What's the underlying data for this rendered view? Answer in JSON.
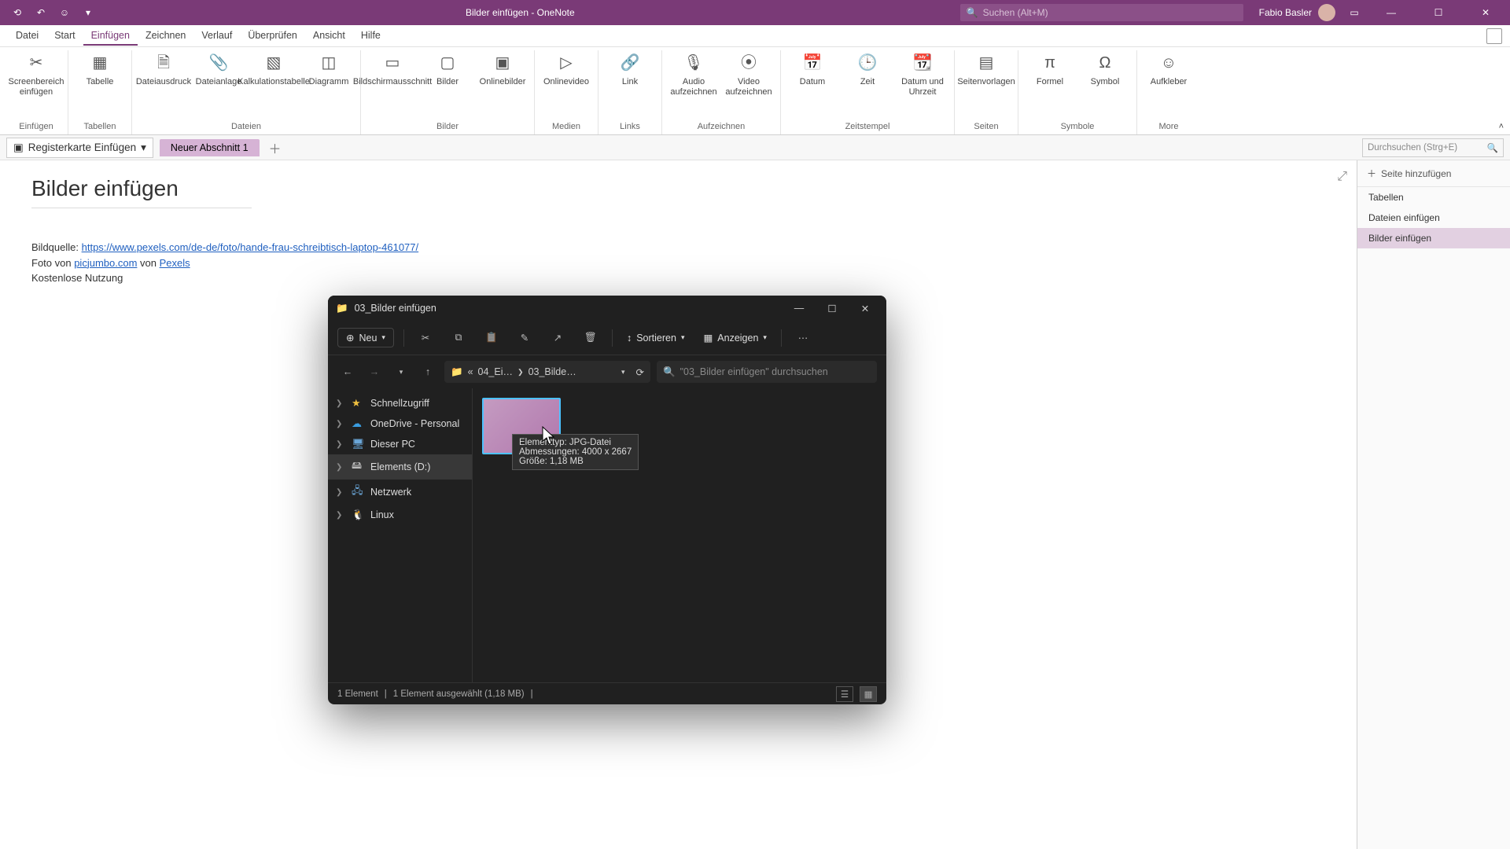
{
  "titlebar": {
    "doc_title": "Bilder einfügen  -  OneNote",
    "search_placeholder": "Suchen (Alt+M)",
    "user_name": "Fabio Basler"
  },
  "menu": {
    "tabs": [
      "Datei",
      "Start",
      "Einfügen",
      "Zeichnen",
      "Verlauf",
      "Überprüfen",
      "Ansicht",
      "Hilfe"
    ],
    "active_index": 2
  },
  "ribbon": {
    "groups": [
      {
        "label": "Einfügen",
        "items": [
          {
            "label": "Screenbereich einfügen",
            "icon": "✂"
          }
        ]
      },
      {
        "label": "Tabellen",
        "items": [
          {
            "label": "Tabelle",
            "icon": "▦"
          }
        ]
      },
      {
        "label": "Dateien",
        "items": [
          {
            "label": "Dateiausdruck",
            "icon": "🗎"
          },
          {
            "label": "Dateianlage",
            "icon": "📎"
          },
          {
            "label": "Kalkulationstabelle",
            "icon": "▧"
          },
          {
            "label": "Diagramm",
            "icon": "◫"
          }
        ]
      },
      {
        "label": "Bilder",
        "items": [
          {
            "label": "Bildschirmausschnitt",
            "icon": "▭"
          },
          {
            "label": "Bilder",
            "icon": "▢"
          },
          {
            "label": "Onlinebilder",
            "icon": "▣"
          }
        ]
      },
      {
        "label": "Medien",
        "items": [
          {
            "label": "Onlinevideo",
            "icon": "▷"
          }
        ]
      },
      {
        "label": "Links",
        "items": [
          {
            "label": "Link",
            "icon": "🔗"
          }
        ]
      },
      {
        "label": "Aufzeichnen",
        "items": [
          {
            "label": "Audio aufzeichnen",
            "icon": "🎙"
          },
          {
            "label": "Video aufzeichnen",
            "icon": "⦿"
          }
        ]
      },
      {
        "label": "Zeitstempel",
        "items": [
          {
            "label": "Datum",
            "icon": "📅"
          },
          {
            "label": "Zeit",
            "icon": "🕒"
          },
          {
            "label": "Datum und Uhrzeit",
            "icon": "📆"
          }
        ]
      },
      {
        "label": "Seiten",
        "items": [
          {
            "label": "Seitenvorlagen",
            "icon": "▤"
          }
        ]
      },
      {
        "label": "Symbole",
        "items": [
          {
            "label": "Formel",
            "icon": "π"
          },
          {
            "label": "Symbol",
            "icon": "Ω"
          }
        ]
      },
      {
        "label": "More",
        "items": [
          {
            "label": "Aufkleber",
            "icon": "☺"
          }
        ]
      }
    ]
  },
  "sections": {
    "notebook": "Registerkarte Einfügen",
    "active_section": "Neuer Abschnitt 1",
    "search_placeholder": "Durchsuchen (Strg+E)"
  },
  "page": {
    "title": "Bilder einfügen",
    "source_label": "Bildquelle: ",
    "source_url": "https://www.pexels.com/de-de/foto/hande-frau-schreibtisch-laptop-461077/",
    "credit_prefix": "Foto von ",
    "credit_author": "picjumbo.com",
    "credit_mid": " von ",
    "credit_site": "Pexels",
    "license": "Kostenlose Nutzung"
  },
  "right_pane": {
    "add_page": "Seite hinzufügen",
    "pages": [
      "Tabellen",
      "Dateien einfügen",
      "Bilder einfügen"
    ],
    "active_index": 2
  },
  "explorer": {
    "title": "03_Bilder einfügen",
    "new_label": "Neu",
    "sort_label": "Sortieren",
    "view_label": "Anzeigen",
    "path_crumbs": [
      "«",
      "04_Ei…",
      "03_Bilde…"
    ],
    "search_placeholder": "\"03_Bilder einfügen\" durchsuchen",
    "tree": [
      {
        "label": "Schnellzugriff",
        "icon": "★",
        "color": "#f0c040"
      },
      {
        "label": "OneDrive - Personal",
        "icon": "☁",
        "color": "#3a9de0"
      },
      {
        "label": "Dieser PC",
        "icon": "🖥",
        "color": "#6aa6d8"
      },
      {
        "label": "Elements (D:)",
        "icon": "🖴",
        "color": "#bbb",
        "selected": true
      },
      {
        "label": "Netzwerk",
        "icon": "🖧",
        "color": "#6aa6d8"
      },
      {
        "label": "Linux",
        "icon": "🐧",
        "color": "#ddd"
      }
    ],
    "tooltip": {
      "line1": "Elementtyp: JPG-Datei",
      "line2": "Abmessungen: 4000 x 2667",
      "line3": "Größe: 1,18 MB"
    },
    "status": {
      "count": "1 Element",
      "selection": "1 Element ausgewählt (1,18 MB)"
    }
  }
}
